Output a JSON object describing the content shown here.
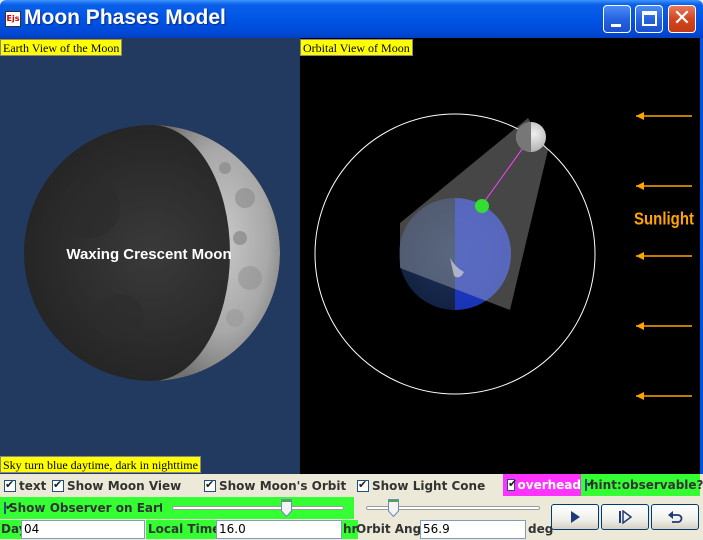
{
  "window": {
    "title": "Moon Phases Model",
    "app_icon": "ejs-icon",
    "buttons": [
      "minimize",
      "maximize",
      "close"
    ]
  },
  "earth_view": {
    "label": "Earth View of the Moon",
    "phase_text": "Waxing Crescent Moon",
    "footer_label": "Sky turn blue daytime, dark in nighttime",
    "sky_color": "#223a60"
  },
  "orbital_view": {
    "label": "Orbital View of Moon",
    "sunlight_label": "Sunlight",
    "sunlight_arrow_count": 5,
    "orbit_color": "#ffffff",
    "observer_color": "#33dd33",
    "sight_line_color": "#ff44ff",
    "arrow_color": "#ffa500"
  },
  "controls": {
    "checkboxes": [
      {
        "label": "text",
        "checked": true
      },
      {
        "label": "Show Moon View",
        "checked": true
      },
      {
        "label": "Show Moon's Orbit",
        "checked": true
      },
      {
        "label": "Show Light Cone",
        "checked": true
      },
      {
        "label": "overhead",
        "checked": true,
        "bg": "#ff33ff"
      },
      {
        "label": "hint:observable?",
        "checked": true,
        "bg": "#33ff33"
      },
      {
        "label": "Show Observer on Earth",
        "checked": true,
        "bg": "#33ff33"
      }
    ],
    "time_slider": {
      "value_fraction": 0.667
    },
    "angle_slider": {
      "value_fraction": 0.158
    },
    "day_label": "Day",
    "day_value": "04",
    "local_time_label": "Local Time:",
    "local_time_value": "16.0",
    "local_time_unit": "hr",
    "orbit_angle_label": "Orbit Angle",
    "orbit_angle_value": "56.9",
    "orbit_angle_unit": "deg",
    "buttons": [
      {
        "name": "play",
        "icon": "play-icon"
      },
      {
        "name": "step",
        "icon": "step-forward-icon"
      },
      {
        "name": "reset",
        "icon": "reset-icon"
      }
    ]
  }
}
